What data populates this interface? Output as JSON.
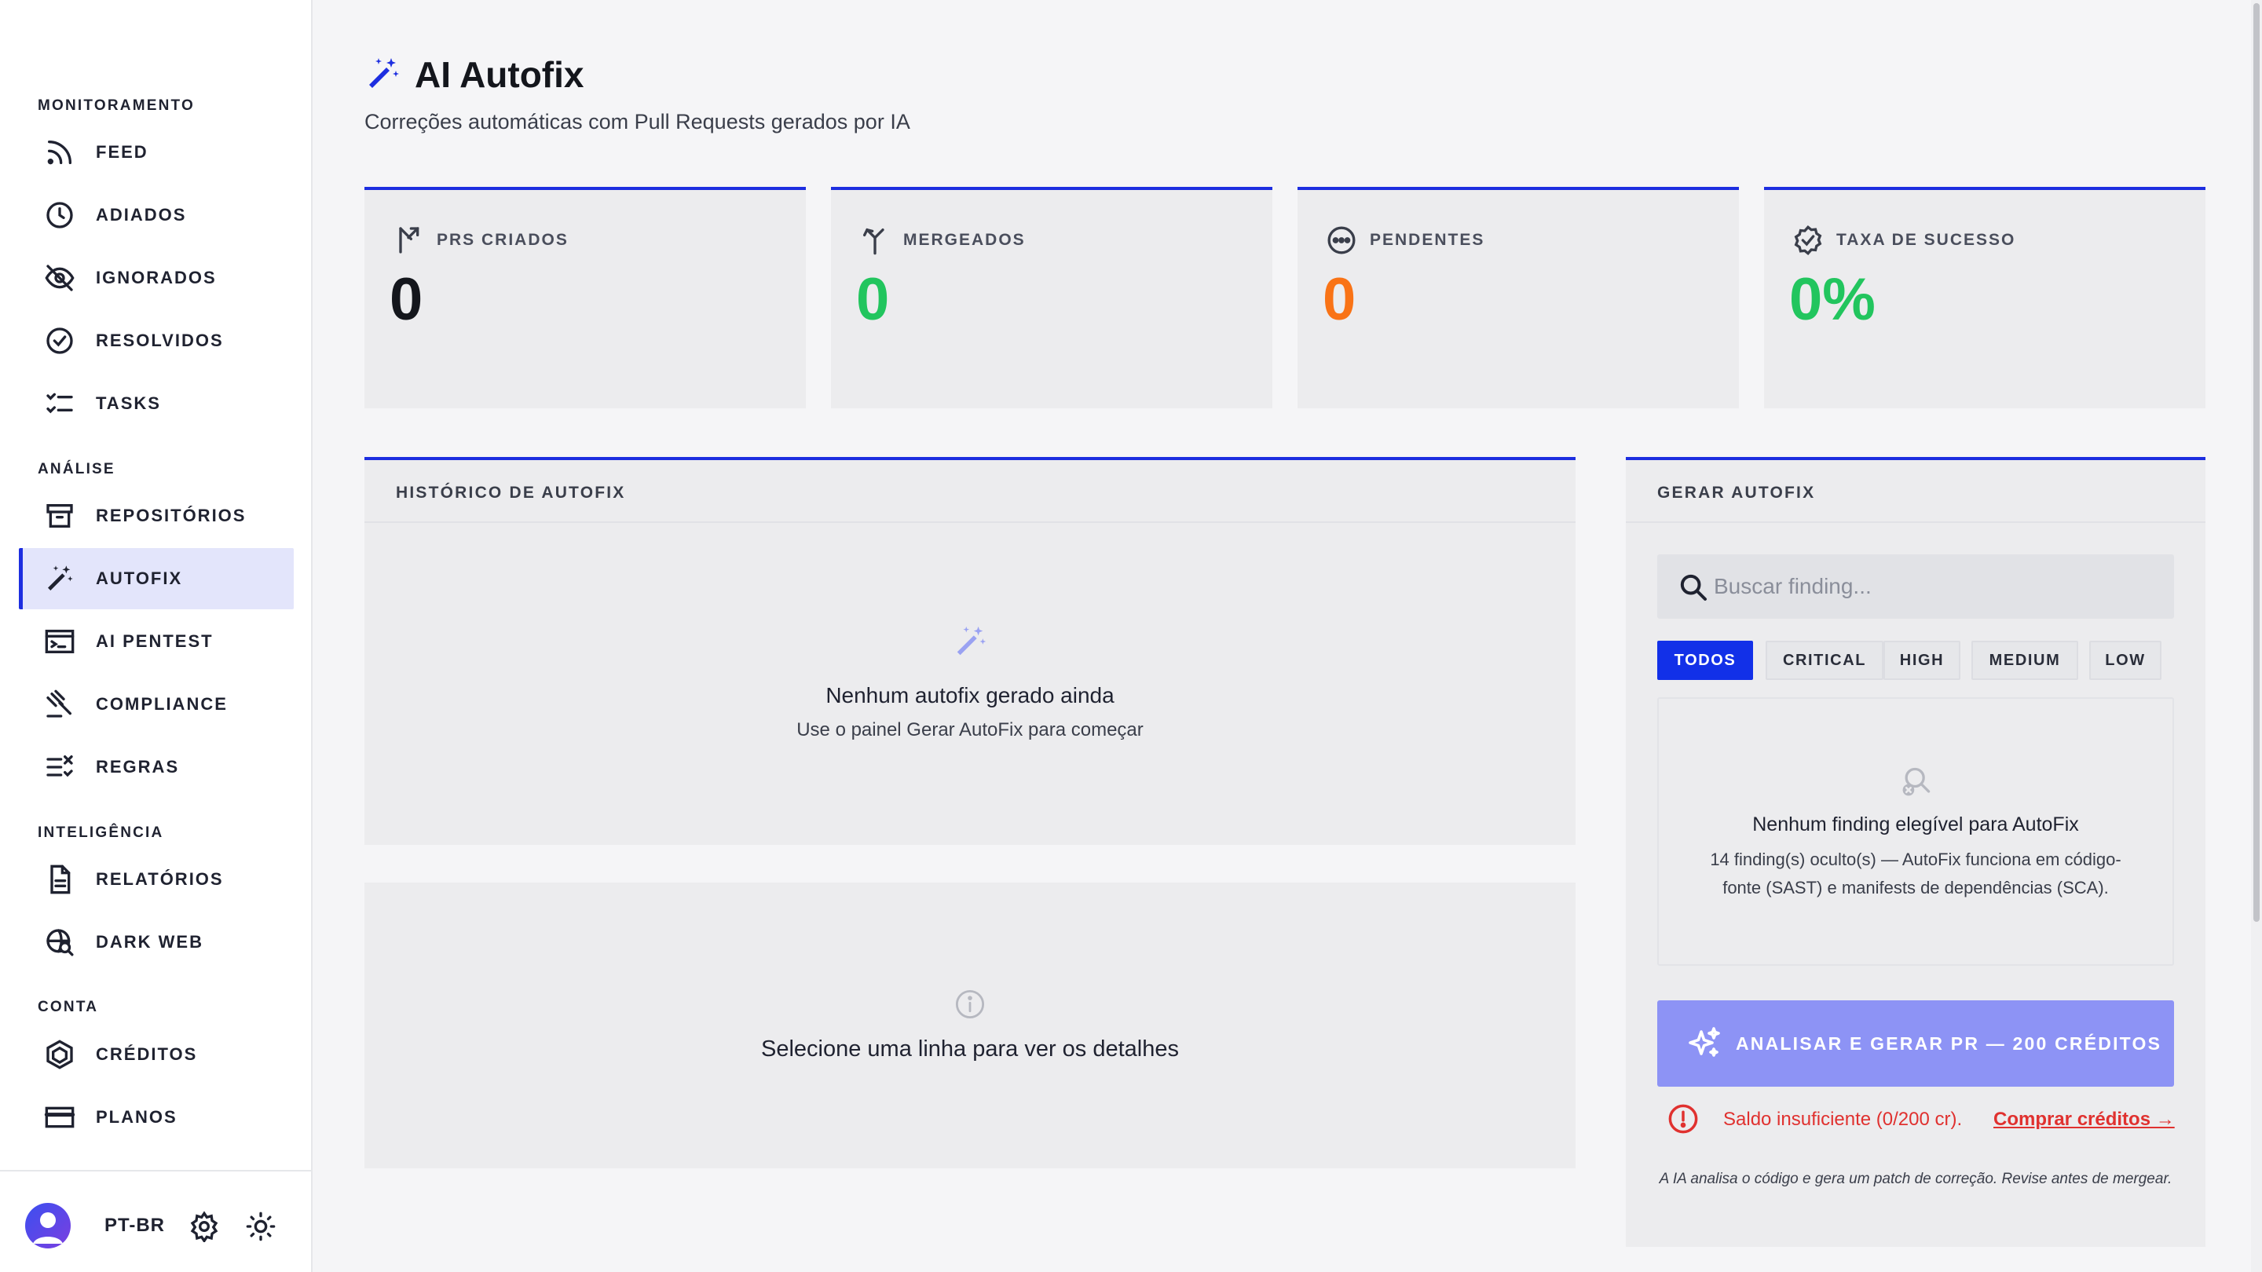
{
  "sidebar": {
    "sections": [
      {
        "title": "MONITORAMENTO",
        "items": [
          {
            "label": "FEED",
            "icon": "rss-icon"
          },
          {
            "label": "ADIADOS",
            "icon": "clock-icon"
          },
          {
            "label": "IGNORADOS",
            "icon": "eye-off-icon"
          },
          {
            "label": "RESOLVIDOS",
            "icon": "check-circle-icon"
          },
          {
            "label": "TASKS",
            "icon": "checklist-icon"
          }
        ]
      },
      {
        "title": "ANÁLISE",
        "items": [
          {
            "label": "REPOSITÓRIOS",
            "icon": "archive-icon"
          },
          {
            "label": "AUTOFIX",
            "icon": "magic-wand-icon",
            "active": true
          },
          {
            "label": "AI PENTEST",
            "icon": "terminal-icon"
          },
          {
            "label": "COMPLIANCE",
            "icon": "gavel-icon"
          },
          {
            "label": "REGRAS",
            "icon": "rules-icon"
          }
        ]
      },
      {
        "title": "INTELIGÊNCIA",
        "items": [
          {
            "label": "RELATÓRIOS",
            "icon": "document-icon"
          },
          {
            "label": "DARK WEB",
            "icon": "globe-search-icon"
          }
        ]
      },
      {
        "title": "CONTA",
        "items": [
          {
            "label": "CRÉDITOS",
            "icon": "hexagon-coin-icon"
          },
          {
            "label": "PLANOS",
            "icon": "credit-card-icon"
          }
        ]
      }
    ],
    "footer": {
      "language": "PT-BR"
    }
  },
  "header": {
    "title": "AI Autofix",
    "subtitle": "Correções automáticas com Pull Requests gerados por IA"
  },
  "stats": [
    {
      "label": "PRS CRIADOS",
      "value": "0",
      "color": "#14161c",
      "icon": "pull-request-icon"
    },
    {
      "label": "MERGEADOS",
      "value": "0",
      "color": "#22c55e",
      "icon": "merge-icon"
    },
    {
      "label": "PENDENTES",
      "value": "0",
      "color": "#f97316",
      "icon": "more-circle-icon"
    },
    {
      "label": "TAXA DE SUCESSO",
      "value": "0%",
      "color": "#22c55e",
      "icon": "verified-badge-icon"
    }
  ],
  "history": {
    "title": "HISTÓRICO DE AUTOFIX",
    "empty_title": "Nenhum autofix gerado ainda",
    "empty_sub": "Use o painel Gerar AutoFix para começar"
  },
  "details": {
    "empty_text": "Selecione uma linha para ver os detalhes"
  },
  "generate": {
    "title": "GERAR AUTOFIX",
    "search_placeholder": "Buscar finding...",
    "filters": [
      "TODOS",
      "CRITICAL",
      "HIGH",
      "MEDIUM",
      "LOW"
    ],
    "active_filter": "TODOS",
    "empty_title": "Nenhum finding elegível para AutoFix",
    "empty_sub_line1": "14 finding(s) oculto(s) — AutoFix funciona em código-",
    "empty_sub_line2": "fonte (SAST) e manifests de dependências (SCA).",
    "cta_label": "ANALISAR E GERAR PR — 200 CRÉDITOS",
    "warning_text": "Saldo insuficiente (0/200 cr).",
    "warning_link": "Comprar créditos →",
    "note": "A IA analisa o código e gera um patch de correção. Revise antes de mergear."
  },
  "colors": {
    "accent": "#1d2ee0",
    "cta": "#8d93f5",
    "success": "#22c55e",
    "warning": "#f97316",
    "error": "#e0312f"
  }
}
